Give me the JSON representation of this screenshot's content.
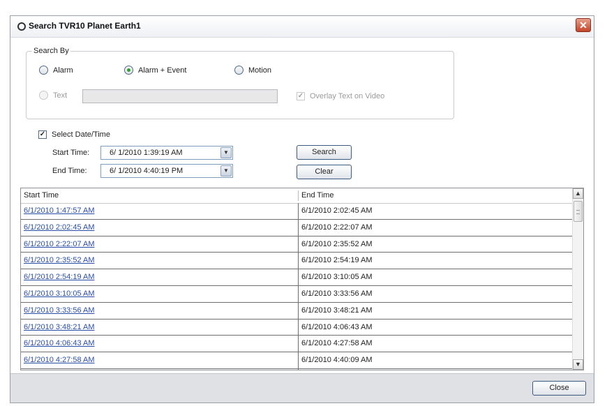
{
  "window": {
    "title": "Search  TVR10  Planet Earth1",
    "close_glyph": "✕"
  },
  "search_by": {
    "legend": "Search By",
    "options": {
      "alarm": "Alarm",
      "alarm_event": "Alarm + Event",
      "motion": "Motion",
      "text": "Text"
    },
    "selected": "Alarm + Event",
    "text_value": "",
    "overlay_label": "Overlay Text on Video"
  },
  "datetime": {
    "checkbox_label": "Select Date/Time",
    "start_label": "Start Time:",
    "start_value": "6/ 1/2010   1:39:19 AM",
    "end_label": "End Time:",
    "end_value": "6/ 1/2010   4:40:19 PM"
  },
  "buttons": {
    "search": "Search",
    "clear": "Clear",
    "close": "Close"
  },
  "table": {
    "headers": [
      "Start Time",
      "End Time"
    ],
    "rows": [
      [
        "6/1/2010 1:47:57 AM",
        "6/1/2010 2:02:45 AM"
      ],
      [
        "6/1/2010 2:02:45 AM",
        "6/1/2010 2:22:07 AM"
      ],
      [
        "6/1/2010 2:22:07 AM",
        "6/1/2010 2:35:52 AM"
      ],
      [
        "6/1/2010 2:35:52 AM",
        "6/1/2010 2:54:19 AM"
      ],
      [
        "6/1/2010 2:54:19 AM",
        "6/1/2010 3:10:05 AM"
      ],
      [
        "6/1/2010 3:10:05 AM",
        "6/1/2010 3:33:56 AM"
      ],
      [
        "6/1/2010 3:33:56 AM",
        "6/1/2010 3:48:21 AM"
      ],
      [
        "6/1/2010 3:48:21 AM",
        "6/1/2010 4:06:43 AM"
      ],
      [
        "6/1/2010 4:06:43 AM",
        "6/1/2010 4:27:58 AM"
      ],
      [
        "6/1/2010 4:27:58 AM",
        "6/1/2010 4:40:09 AM"
      ]
    ]
  },
  "colors": {
    "link": "#2a4fa8",
    "selected_radio": "#2fa02f",
    "close_button": "#c4442a"
  }
}
